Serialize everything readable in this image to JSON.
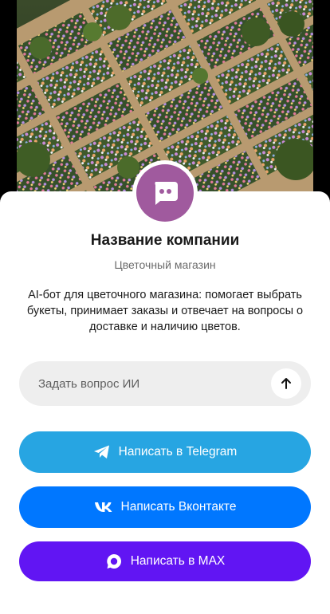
{
  "company": {
    "name": "Название компании",
    "type": "Цветочный магазин",
    "description": "AI-бот для цветочного магазина: помогает выбрать букеты, принимает заказы и отвечает на вопросы о доставке и наличию цветов."
  },
  "ask": {
    "placeholder": "Задать вопрос ИИ",
    "send_icon": "arrow-up-icon"
  },
  "buttons": {
    "telegram": {
      "label": "Написать в Telegram",
      "icon": "telegram-icon",
      "color": "#27a5e2"
    },
    "vk": {
      "label": "Написать Вконтакте",
      "icon": "vk-icon",
      "color": "#0077ff"
    },
    "max": {
      "label": "Написать в MAX",
      "icon": "max-icon",
      "color": "#6115f3"
    }
  },
  "colors": {
    "avatar": "#a05a9e",
    "card_bg": "#ffffff",
    "input_bg": "#eeeeee"
  },
  "avatar_icon": "chat-bot-icon"
}
